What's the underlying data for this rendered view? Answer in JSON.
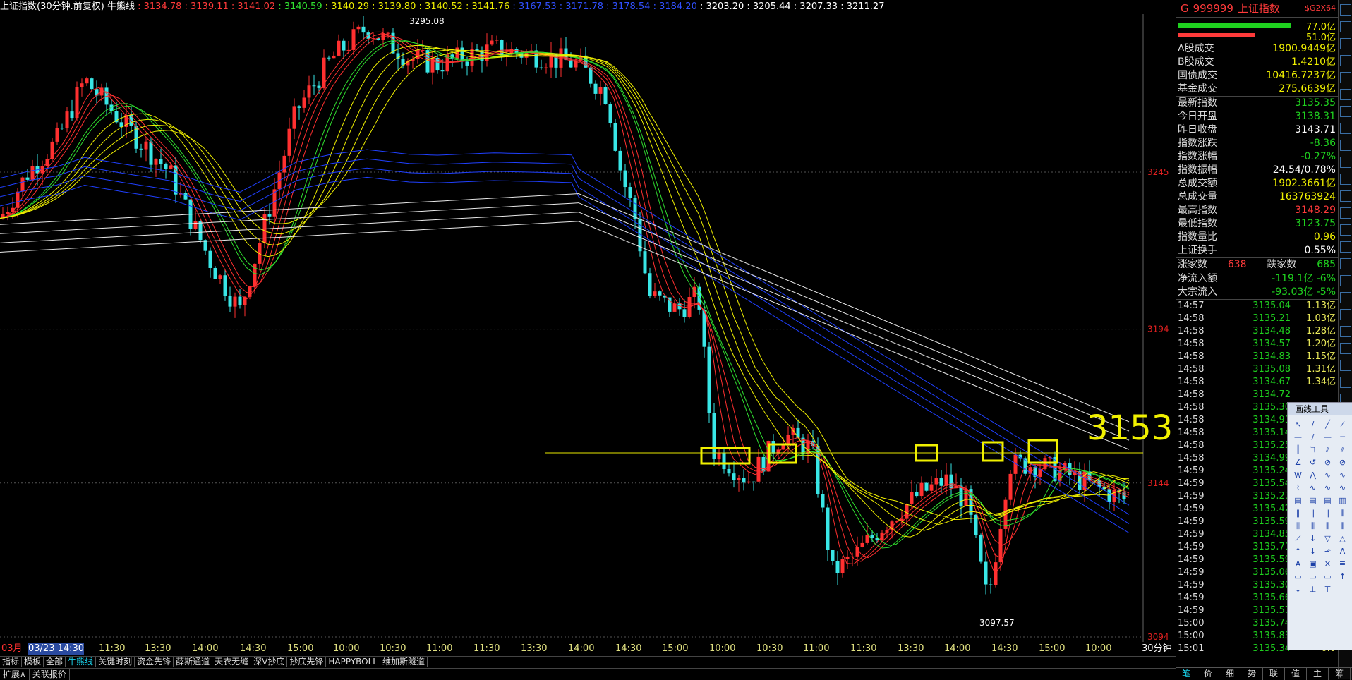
{
  "header": {
    "title": "上证指数(30分钟.前复权) 牛熊线",
    "values": [
      {
        "v": "3134.78",
        "c": "#ff3a3a"
      },
      {
        "v": "3139.11",
        "c": "#ff3a3a"
      },
      {
        "v": "3141.02",
        "c": "#ff3a3a"
      },
      {
        "v": "3140.59",
        "c": "#30e030"
      },
      {
        "v": "3140.29",
        "c": "#f0f000"
      },
      {
        "v": "3139.80",
        "c": "#f0f000"
      },
      {
        "v": "3140.52",
        "c": "#f0f000"
      },
      {
        "v": "3141.76",
        "c": "#f0f000"
      },
      {
        "v": "3167.53",
        "c": "#3050ff"
      },
      {
        "v": "3171.78",
        "c": "#3050ff"
      },
      {
        "v": "3178.54",
        "c": "#3050ff"
      },
      {
        "v": "3184.20",
        "c": "#3050ff"
      },
      {
        "v": "3203.20",
        "c": "#ffffff"
      },
      {
        "v": "3205.44",
        "c": "#ffffff"
      },
      {
        "v": "3207.33",
        "c": "#ffffff"
      },
      {
        "v": "3211.27",
        "c": "#ffffff"
      }
    ]
  },
  "chart_data": {
    "type": "candlestick",
    "ylabels": [
      "3245",
      "3194",
      "3144",
      "3094"
    ],
    "high_label": "3295.08",
    "low_label": "3097.57",
    "annotation": "3153",
    "xlabels": [
      "03月",
      "03/23 14:30",
      "11:30",
      "13:30",
      "14:00",
      "14:30",
      "15:00",
      "10:00",
      "10:30",
      "11:00",
      "11:30",
      "13:30",
      "14:00",
      "14:30",
      "15:00",
      "10:00",
      "10:30",
      "11:00",
      "11:30",
      "13:30",
      "14:00",
      "14:30",
      "15:00",
      "10:00"
    ],
    "period": "30分钟"
  },
  "tabs": [
    "指标",
    "模板",
    "全部",
    "牛熊线",
    "关键时刻",
    "资金先锋",
    "薛斯通道",
    "天衣无缝",
    "深V抄底",
    "抄底先锋",
    "HAPPYBOLL",
    "维加斯隧道"
  ],
  "active_tab": "牛熊线",
  "bottom": [
    "扩展∧",
    "关联报价"
  ],
  "panel": {
    "code": "999999",
    "name": "上证指数",
    "tag": "$G2X64",
    "flow_up": "77.0亿",
    "flow_down": "51.0亿",
    "stats1": [
      {
        "k": "A股成交",
        "v": "1900.9449亿",
        "c": "#f0f000"
      },
      {
        "k": "B股成交",
        "v": "1.4210亿",
        "c": "#f0f000"
      },
      {
        "k": "国债成交",
        "v": "10416.7237亿",
        "c": "#f0f000"
      },
      {
        "k": "基金成交",
        "v": "275.6639亿",
        "c": "#f0f000"
      }
    ],
    "stats2": [
      {
        "k": "最新指数",
        "v": "3135.35",
        "c": "#1fd11f"
      },
      {
        "k": "今日开盘",
        "v": "3138.31",
        "c": "#1fd11f"
      },
      {
        "k": "昨日收盘",
        "v": "3143.71",
        "c": "#ffffff"
      },
      {
        "k": "指数涨跌",
        "v": "-8.36",
        "c": "#1fd11f"
      },
      {
        "k": "指数涨幅",
        "v": "-0.27%",
        "c": "#1fd11f"
      },
      {
        "k": "指数振幅",
        "v": "24.54/0.78%",
        "c": "#ffffff"
      },
      {
        "k": "总成交额",
        "v": "1902.3661亿",
        "c": "#f0f000"
      },
      {
        "k": "总成交量",
        "v": "163763924",
        "c": "#f0f000"
      },
      {
        "k": "最高指数",
        "v": "3148.29",
        "c": "#ff3a3a"
      },
      {
        "k": "最低指数",
        "v": "3123.75",
        "c": "#1fd11f"
      },
      {
        "k": "指数量比",
        "v": "0.96",
        "c": "#f0f000"
      },
      {
        "k": "上证换手",
        "v": "0.55%",
        "c": "#ffffff"
      }
    ],
    "updown": {
      "up_label": "涨家数",
      "up": "638",
      "down_label": "跌家数",
      "down": "685"
    },
    "flows": [
      {
        "k": "净流入额",
        "v": "-119.1亿",
        "p": "-6%"
      },
      {
        "k": "大宗流入",
        "v": "-93.03亿",
        "p": "-5%"
      }
    ],
    "ticks": [
      [
        "14:57",
        "3135.04",
        "1.13亿"
      ],
      [
        "14:58",
        "3135.21",
        "1.03亿"
      ],
      [
        "14:58",
        "3134.48",
        "1.28亿"
      ],
      [
        "14:58",
        "3134.57",
        "1.20亿"
      ],
      [
        "14:58",
        "3134.83",
        "1.15亿"
      ],
      [
        "14:58",
        "3135.08",
        "1.31亿"
      ],
      [
        "14:58",
        "3134.67",
        "1.34亿"
      ],
      [
        "14:58",
        "3134.72",
        ""
      ],
      [
        "14:58",
        "3135.30",
        ""
      ],
      [
        "14:58",
        "3134.91",
        ""
      ],
      [
        "14:58",
        "3135.14",
        ""
      ],
      [
        "14:58",
        "3135.25",
        ""
      ],
      [
        "14:58",
        "3134.99",
        ""
      ],
      [
        "14:59",
        "3135.24",
        ""
      ],
      [
        "14:59",
        "3135.54",
        ""
      ],
      [
        "14:59",
        "3135.27",
        ""
      ],
      [
        "14:59",
        "3135.42",
        ""
      ],
      [
        "14:59",
        "3135.59",
        ""
      ],
      [
        "14:59",
        "3134.85",
        ""
      ],
      [
        "14:59",
        "3135.71",
        ""
      ],
      [
        "14:59",
        "3135.59",
        ""
      ],
      [
        "14:59",
        "3135.06",
        ""
      ],
      [
        "14:59",
        "3135.30",
        ""
      ],
      [
        "14:59",
        "3135.66",
        ""
      ],
      [
        "14:59",
        "3135.57",
        ""
      ],
      [
        "15:00",
        "3135.74",
        ""
      ],
      [
        "15:00",
        "3135.83",
        ""
      ],
      [
        "15:01",
        "3135.34",
        "0.0"
      ]
    ],
    "rtabs": [
      "笔",
      "价",
      "细",
      "势",
      "联",
      "值",
      "主",
      "筹"
    ]
  },
  "tool": {
    "title": "画线工具"
  }
}
